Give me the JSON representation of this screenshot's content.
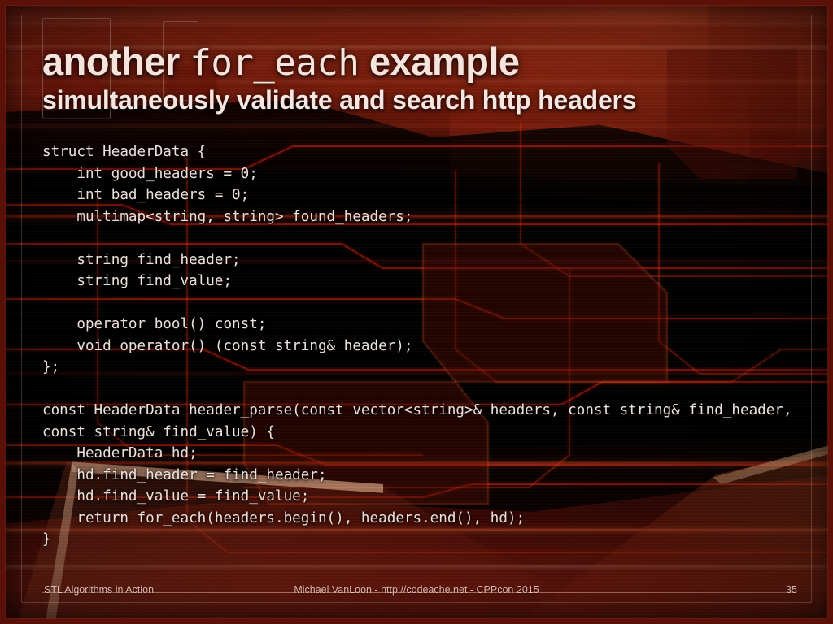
{
  "slide": {
    "title": {
      "part1": "another",
      "part2": "for_each",
      "part3": "example"
    },
    "subtitle": "simultaneously validate and search http headers",
    "code_lines": [
      "struct HeaderData {",
      "    int good_headers = 0;",
      "    int bad_headers = 0;",
      "    multimap<string, string> found_headers;",
      "",
      "    string find_header;",
      "    string find_value;",
      "",
      "    operator bool() const;",
      "    void operator() (const string& header);",
      "};",
      "",
      "const HeaderData header_parse(const vector<string>& headers, const string& find_header, const string& find_value) {",
      "    HeaderData hd;",
      "    hd.find_header = find_header;",
      "    hd.find_value = find_value;",
      "    return for_each(headers.begin(), headers.end(), hd);",
      "}"
    ],
    "footer": {
      "left": "STL Algorithms in Action",
      "center": "Michael VanLoon - http://codeache.net - CPPcon 2015",
      "page_number": "35"
    },
    "colors": {
      "background_dark": "#0a0201",
      "background_red": "#8e2310",
      "accent_orange": "#eb7837",
      "title_text": "#f6e3dc",
      "code_text": "#ece0da",
      "footer_text": "#f0c9bd"
    }
  }
}
